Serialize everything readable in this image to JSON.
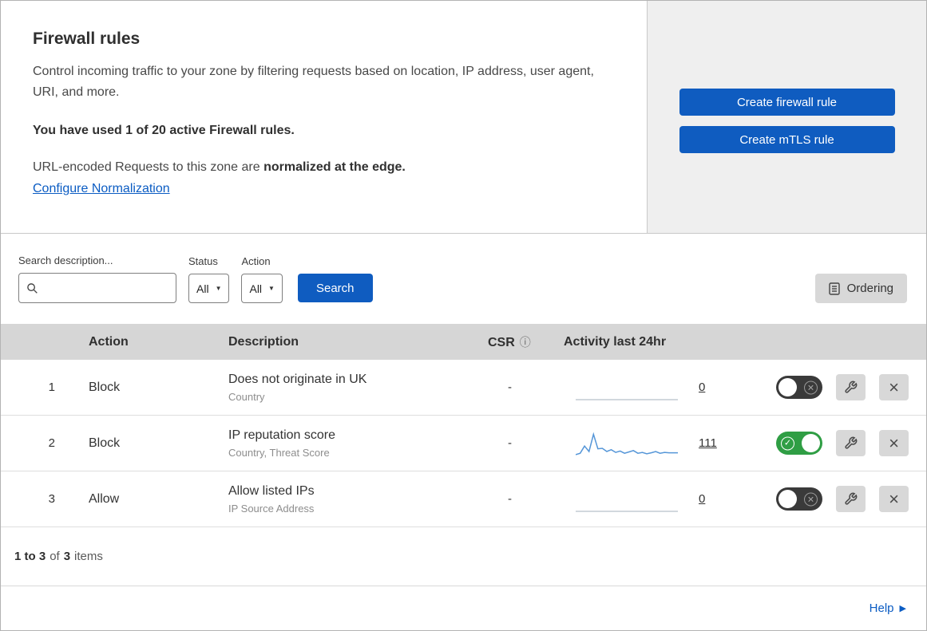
{
  "colors": {
    "accent_blue": "#0f5cc0",
    "link_blue": "#0b5cc3",
    "toggle_green": "#2f9e44",
    "toggle_off_gray": "#3a3a3a",
    "sparkline_blue": "#5596d8"
  },
  "header": {
    "title": "Firewall rules",
    "description": "Control incoming traffic to your zone by filtering requests based on location, IP address, user agent, URI, and more.",
    "usage": "You have used 1 of 20 active Firewall rules.",
    "normalization_prefix": "URL-encoded Requests to this zone are ",
    "normalization_bold": "normalized at the edge.",
    "normalization_link": "Configure Normalization",
    "create_firewall_label": "Create firewall rule",
    "create_mtls_label": "Create mTLS rule"
  },
  "filters": {
    "search_label": "Search description...",
    "search_value": "",
    "search_placeholder": "",
    "status_label": "Status",
    "status_value": "All",
    "action_label": "Action",
    "action_value": "All",
    "search_button": "Search",
    "ordering_button": "Ordering"
  },
  "table": {
    "headers": {
      "action": "Action",
      "description": "Description",
      "csr": "CSR",
      "csr_info_icon": "ⓘ",
      "activity": "Activity last 24hr"
    },
    "rows": [
      {
        "index": "1",
        "action": "Block",
        "description": "Does not originate in UK",
        "fields": "Country",
        "csr": "-",
        "activity_count": "0",
        "enabled": false,
        "sparkline": [
          0,
          0,
          0,
          0,
          0,
          0,
          0,
          0,
          0,
          0
        ]
      },
      {
        "index": "2",
        "action": "Block",
        "description": "IP reputation score",
        "fields": "Country, Threat Score",
        "csr": "-",
        "activity_count": "111",
        "enabled": true,
        "sparkline": [
          4,
          10,
          42,
          18,
          95,
          30,
          32,
          18,
          26,
          14,
          20,
          10,
          16,
          22,
          10,
          14,
          8,
          12,
          18,
          10,
          14,
          12,
          12,
          12
        ]
      },
      {
        "index": "3",
        "action": "Allow",
        "description": "Allow listed IPs",
        "fields": "IP Source Address",
        "csr": "-",
        "activity_count": "0",
        "enabled": false,
        "sparkline": [
          0,
          0,
          0,
          0,
          0,
          0,
          0,
          0,
          0,
          0
        ]
      }
    ],
    "footer": {
      "range": "1 to 3",
      "of": "of",
      "total": "3",
      "items": "items"
    }
  },
  "help": {
    "label": "Help"
  }
}
